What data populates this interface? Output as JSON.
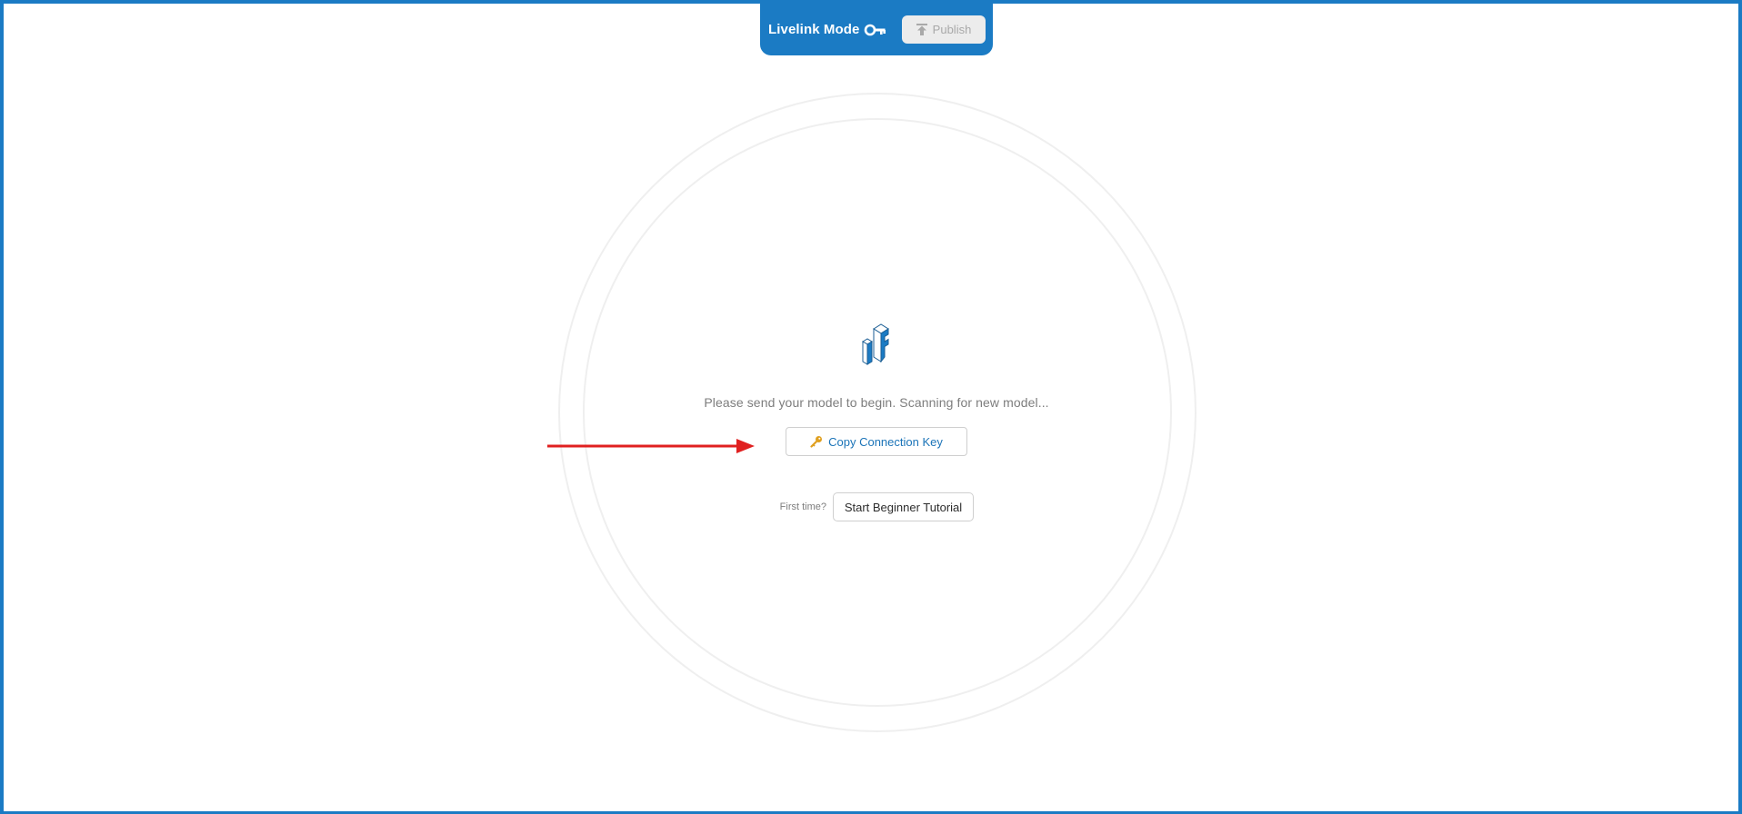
{
  "header": {
    "mode_label": "Livelink Mode",
    "key_icon": "key-icon",
    "publish_label": "Publish",
    "publish_icon": "upload-icon"
  },
  "main": {
    "logo": "app-logo-icon",
    "status_text": "Please send your model to begin. Scanning for new model...",
    "copy_key_label": "Copy Connection Key",
    "copy_key_icon": "key-icon",
    "first_time_label": "First time?",
    "tutorial_label": "Start Beginner Tutorial"
  },
  "colors": {
    "accent": "#1b7bc4",
    "key_icon_color": "#e0a020",
    "annotation_arrow": "#e02020",
    "circle_stroke": "#efefef"
  }
}
